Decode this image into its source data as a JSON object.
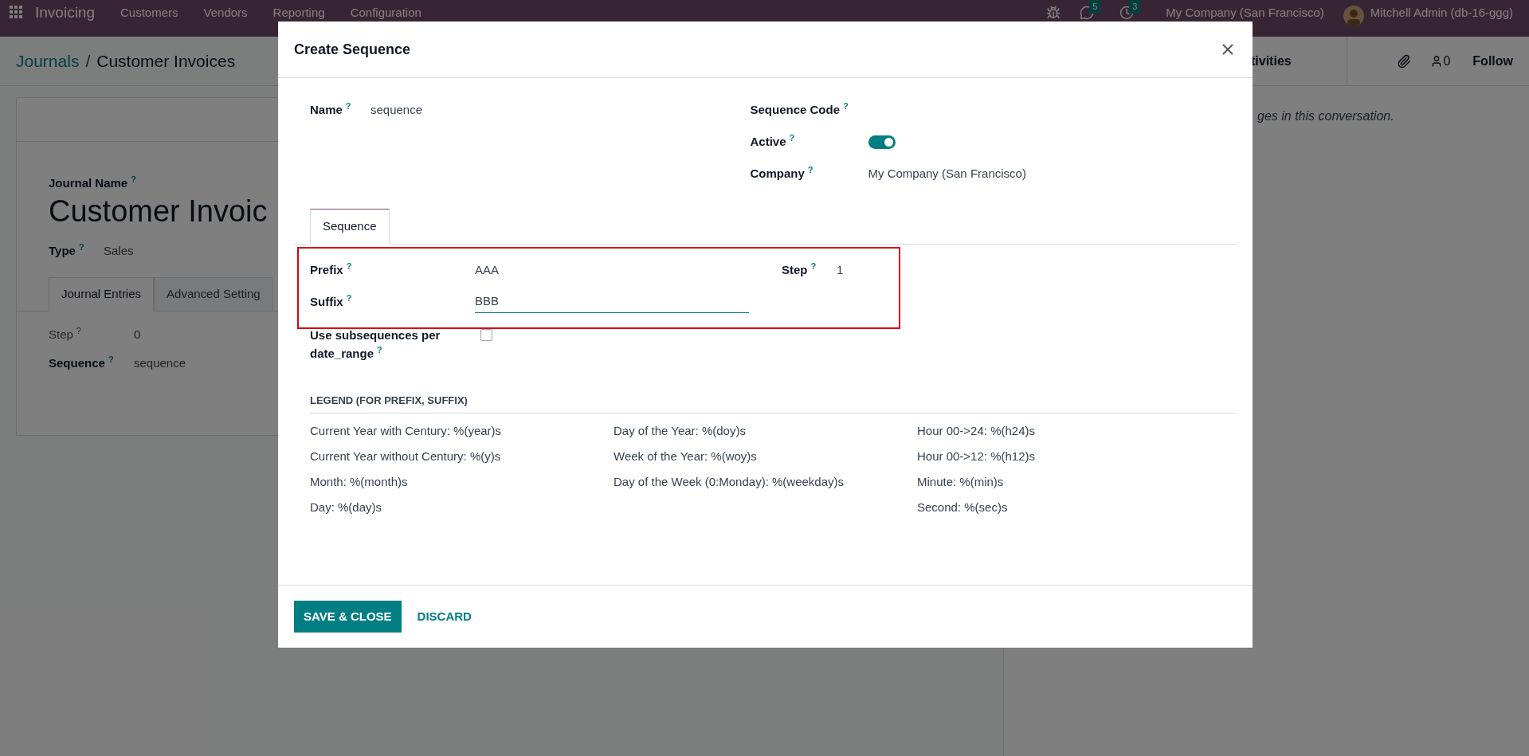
{
  "navbar": {
    "app_name": "Invoicing",
    "menu": [
      "Customers",
      "Vendors",
      "Reporting",
      "Configuration"
    ],
    "messages_count": "5",
    "activities_count": "3",
    "company": "My Company (San Francisco)",
    "user": "Mitchell Admin (db-16-ggg)"
  },
  "breadcrumb": [
    "Journals",
    "/",
    "Customer Invoices"
  ],
  "form": {
    "name_label": "Journal Name",
    "name_help": "?",
    "title": "Customer Invoic",
    "type": {
      "label": "Type",
      "help": "?",
      "value": "Sales"
    },
    "tabs": [
      {
        "label": "Journal Entries",
        "selected": true
      },
      {
        "label": "Advanced Setting",
        "selected": false
      }
    ],
    "fields": [
      {
        "label": "Step",
        "help": "?",
        "value": "0",
        "muted": true
      },
      {
        "label": "Sequence",
        "help": "?",
        "value": "sequence",
        "muted": false
      }
    ]
  },
  "chatter": {
    "activities": "tivities",
    "followers": "0",
    "follow": "Follow",
    "message": "ges in this conversation."
  },
  "modal": {
    "title": "Create Sequence",
    "left_fields": [
      {
        "label": "Name",
        "help": "?",
        "value": "sequence"
      }
    ],
    "right_fields": [
      {
        "kind": "text",
        "label": "Sequence Code",
        "help": "?"
      },
      {
        "kind": "toggle",
        "label": "Active",
        "help": "?",
        "on": true
      },
      {
        "kind": "text",
        "label": "Company",
        "help": "?",
        "value": "My Company (San Francisco)"
      }
    ],
    "tabs": [
      {
        "label": "Sequence",
        "selected": true
      }
    ],
    "sequence_fields": [
      {
        "label": "Prefix",
        "help": "?",
        "value": "AAA",
        "focused": false
      },
      {
        "label": "Suffix",
        "help": "?",
        "value": "BBB",
        "focused": true
      }
    ],
    "step": {
      "label": "Step",
      "help": "?",
      "value": "1"
    },
    "subsequences": {
      "label": "Use subsequences per date_range",
      "help": "?",
      "checked": false
    },
    "legend": {
      "heading": "LEGEND (FOR PREFIX, SUFFIX)",
      "columns": [
        [
          "Current Year with Century: %(year)s",
          "Current Year without Century: %(y)s",
          "Month: %(month)s",
          "Day: %(day)s"
        ],
        [
          "Day of the Year: %(doy)s",
          "Week of the Year: %(woy)s",
          "Day of the Week (0:Monday): %(weekday)s"
        ],
        [
          "Hour 00->24: %(h24)s",
          "Hour 00->12: %(h12)s",
          "Minute: %(min)s",
          "Second: %(sec)s"
        ]
      ]
    },
    "buttons": [
      {
        "kind": "primary",
        "label": "SAVE & CLOSE"
      },
      {
        "kind": "link",
        "label": "DISCARD"
      }
    ]
  }
}
